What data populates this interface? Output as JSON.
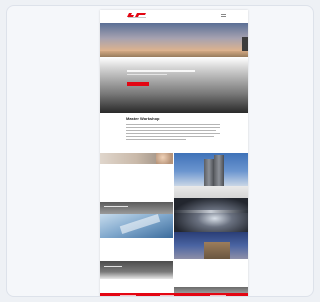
{
  "browser": {
    "page": {
      "header": {
        "logo_icon": "brand-logo",
        "menu_icon": "hamburger-menu-icon"
      },
      "hero": {
        "cta_icon": "red-cta-button"
      },
      "intro": {
        "heading": "Master Workshop"
      },
      "gallery": {
        "tiles": [
          "portrait-photo",
          "skyscraper-photo",
          "interior-photo",
          "tunnel-photo",
          "glass-facade-photo",
          "building-night-photo"
        ]
      },
      "footer": {
        "background_color": "#e30613"
      }
    },
    "colors": {
      "brand": "#e30613",
      "frame_bg": "#f5f7fa"
    }
  }
}
